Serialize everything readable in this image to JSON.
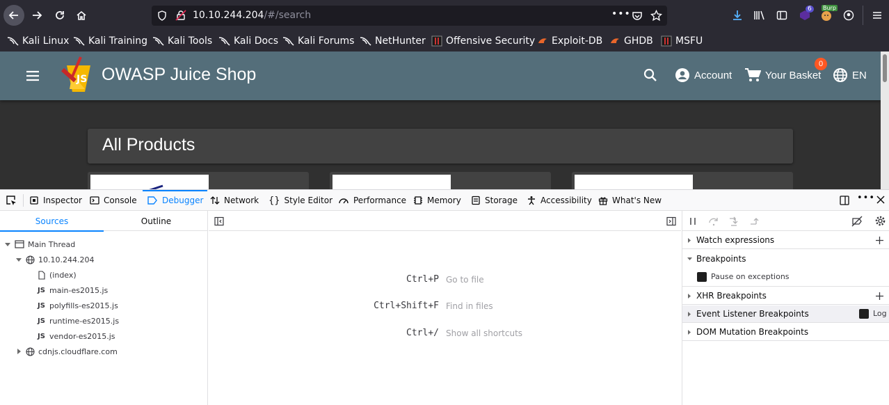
{
  "browser": {
    "url_host": "10.10.244.204",
    "url_path": "/#/search",
    "downloads_badge": "6",
    "burp_label": "Burp"
  },
  "bookmarks": [
    {
      "label": "Kali Linux",
      "icon": "kali-dragon-icon"
    },
    {
      "label": "Kali Training",
      "icon": "kali-dragon-icon"
    },
    {
      "label": "Kali Tools",
      "icon": "kali-dragon-icon"
    },
    {
      "label": "Kali Docs",
      "icon": "kali-dragon-icon"
    },
    {
      "label": "Kali Forums",
      "icon": "kali-dragon-icon"
    },
    {
      "label": "NetHunter",
      "icon": "kali-dragon-icon"
    },
    {
      "label": "Offensive Security",
      "icon": "offsec-icon"
    },
    {
      "label": "Exploit-DB",
      "icon": "exploit-db-icon"
    },
    {
      "label": "GHDB",
      "icon": "ghdb-icon"
    },
    {
      "label": "MSFU",
      "icon": "offsec-icon"
    }
  ],
  "app": {
    "title": "OWASP Juice Shop",
    "account_label": "Account",
    "basket_label": "Your Basket",
    "basket_count": "0",
    "language_label": "EN",
    "section_title": "All Products",
    "toolbar_color": "#546e7a",
    "badge_color": "#ff5722"
  },
  "devtools": {
    "tabs": [
      {
        "label": "Inspector",
        "icon": "inspector-icon"
      },
      {
        "label": "Console",
        "icon": "console-icon"
      },
      {
        "label": "Debugger",
        "icon": "debugger-icon"
      },
      {
        "label": "Network",
        "icon": "network-icon"
      },
      {
        "label": "Style Editor",
        "icon": "style-editor-icon"
      },
      {
        "label": "Performance",
        "icon": "performance-icon"
      },
      {
        "label": "Memory",
        "icon": "memory-icon"
      },
      {
        "label": "Storage",
        "icon": "storage-icon"
      },
      {
        "label": "Accessibility",
        "icon": "accessibility-icon"
      },
      {
        "label": "What's New",
        "icon": "gift-icon"
      }
    ],
    "selected_tab": "Debugger",
    "accent_color": "#0a84ff",
    "source_tabs": [
      "Sources",
      "Outline"
    ],
    "tree": {
      "thread": "Main Thread",
      "host": "10.10.244.204",
      "files": [
        {
          "tag": "",
          "name": "(index)"
        },
        {
          "tag": "JS",
          "name": "main-es2015.js"
        },
        {
          "tag": "JS",
          "name": "polyfills-es2015.js"
        },
        {
          "tag": "JS",
          "name": "runtime-es2015.js"
        },
        {
          "tag": "JS",
          "name": "vendor-es2015.js"
        }
      ],
      "cdn_host": "cdnjs.cloudflare.com"
    },
    "shortcuts": [
      {
        "key": "Ctrl+P",
        "desc": "Go to file"
      },
      {
        "key": "Ctrl+Shift+F",
        "desc": "Find in files"
      },
      {
        "key": "Ctrl+/",
        "desc": "Show all shortcuts"
      }
    ],
    "sidebar": {
      "watch_expressions": "Watch expressions",
      "breakpoints": "Breakpoints",
      "pause_on_exceptions": "Pause on exceptions",
      "xhr_breakpoints": "XHR Breakpoints",
      "event_listener_breakpoints": "Event Listener Breakpoints",
      "log_label": "Log",
      "dom_mutation_breakpoints": "DOM Mutation Breakpoints"
    }
  }
}
